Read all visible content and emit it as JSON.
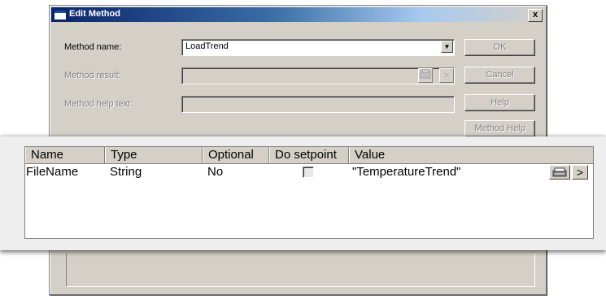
{
  "dialog": {
    "title": "Edit Method",
    "close_label": "x",
    "method_name_label": "Method name:",
    "method_name_value": "LoadTrend",
    "method_result_label": "Method result:",
    "method_result_value": "",
    "method_help_text_label": "Method help text:",
    "method_help_text_value": "",
    "result_more_label": ">",
    "buttons": {
      "ok": "OK",
      "cancel": "Cancel",
      "help": "Help",
      "method_help": "Method Help"
    }
  },
  "parameters": {
    "columns": [
      "Name",
      "Type",
      "Optional",
      "Do setpoint",
      "Value"
    ],
    "rows": [
      {
        "name": "FileName",
        "type": "String",
        "optional": "No",
        "do_setpoint": false,
        "value": "\"TemperatureTrend\"",
        "more_label": ">"
      }
    ]
  },
  "icons": {
    "title": "window-icon",
    "close": "close-icon",
    "dropdown": "chevron-down-icon",
    "browse": "browse-icon"
  }
}
